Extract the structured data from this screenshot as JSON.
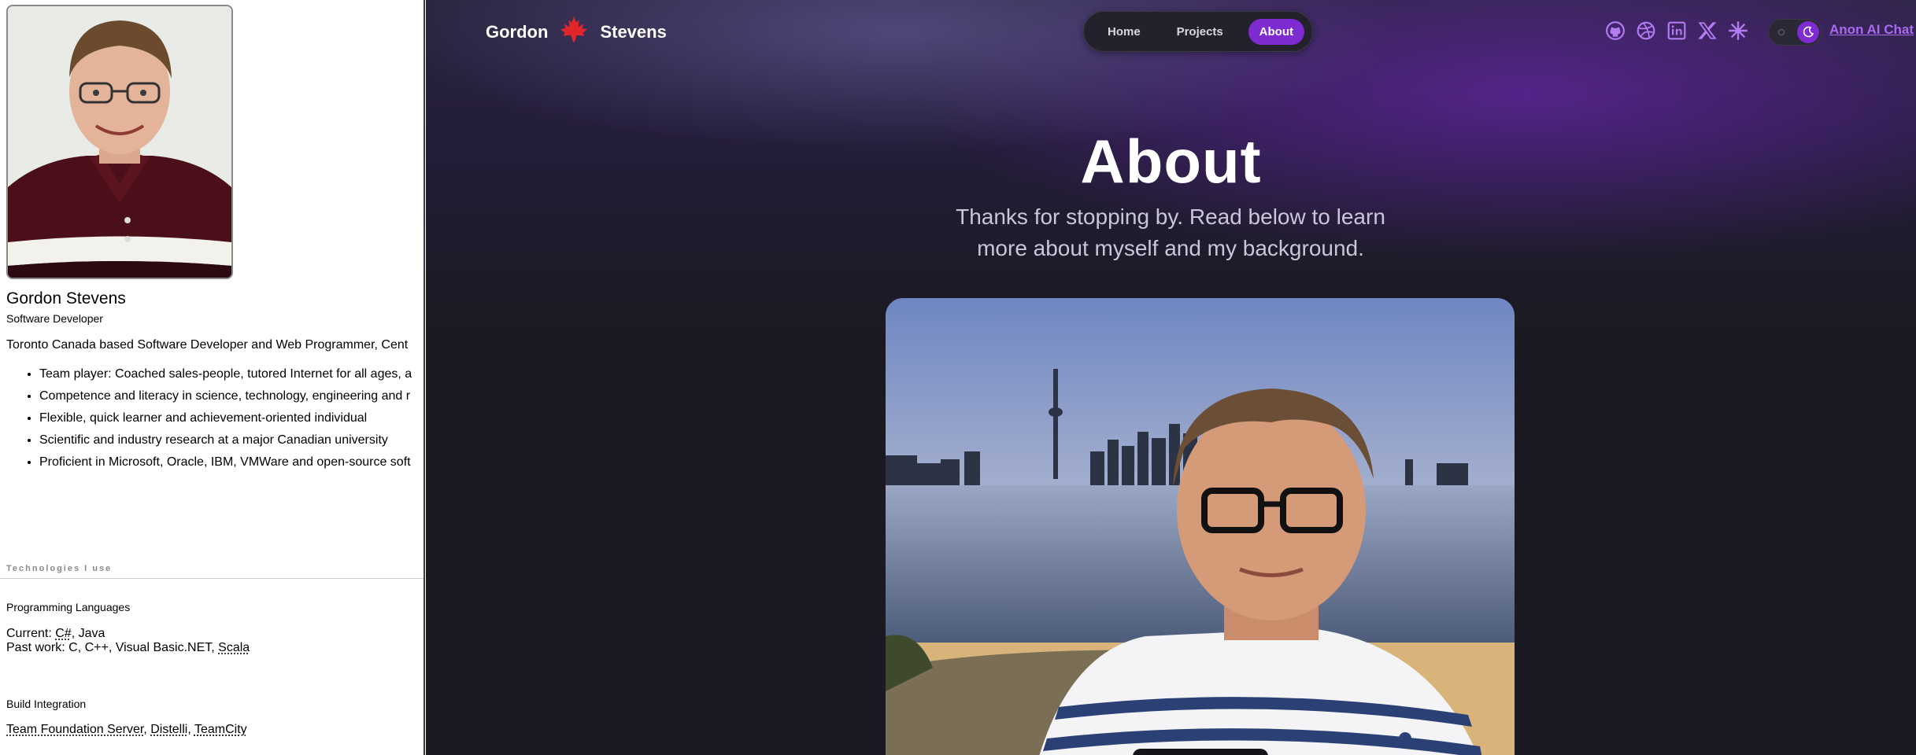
{
  "resume": {
    "name": "Gordon Stevens",
    "role": "Software Developer",
    "summary": "Toronto Canada based Software Developer and Web Programmer, Cent",
    "highlights": [
      "Team player: Coached sales-people, tutored Internet for all ages, a",
      "Competence and literacy in science, technology, engineering and r",
      "Flexible, quick learner and achievement-oriented individual",
      "Scientific and industry research at a major Canadian university",
      "Proficient in Microsoft, Oracle, IBM, VMWare and open-source soft"
    ],
    "tech_heading": "Technologies I use",
    "programming": {
      "title": "Programming Languages",
      "current_label": "Current: ",
      "current_1": "C#",
      "current_sep": ", Java",
      "past_label": "Past work: C, C++, Visual Basic.NET, ",
      "past_link": "Scala"
    },
    "build": {
      "title": "Build Integration",
      "items": [
        "Team Foundation Server",
        "Distelli",
        "TeamCity"
      ],
      "sep": ", "
    }
  },
  "site": {
    "brand_first": "Gordon",
    "brand_last": "Stevens",
    "nav": [
      {
        "label": "Home",
        "active": false
      },
      {
        "label": "Projects",
        "active": false
      },
      {
        "label": "About",
        "active": true
      }
    ],
    "social_icons": [
      "github-icon",
      "dribbble-icon",
      "linkedin-icon",
      "x-icon",
      "sparkle-icon"
    ],
    "theme_toggle": "dark",
    "chat_link": "Anon AI Chat",
    "title": "About",
    "subtitle": "Thanks for stopping by. Read below to learn more about myself and my background.",
    "colors": {
      "accent": "#7e2bd1",
      "link": "#a96af0",
      "maple": "#e0252b",
      "background": "#1b1a22"
    }
  }
}
